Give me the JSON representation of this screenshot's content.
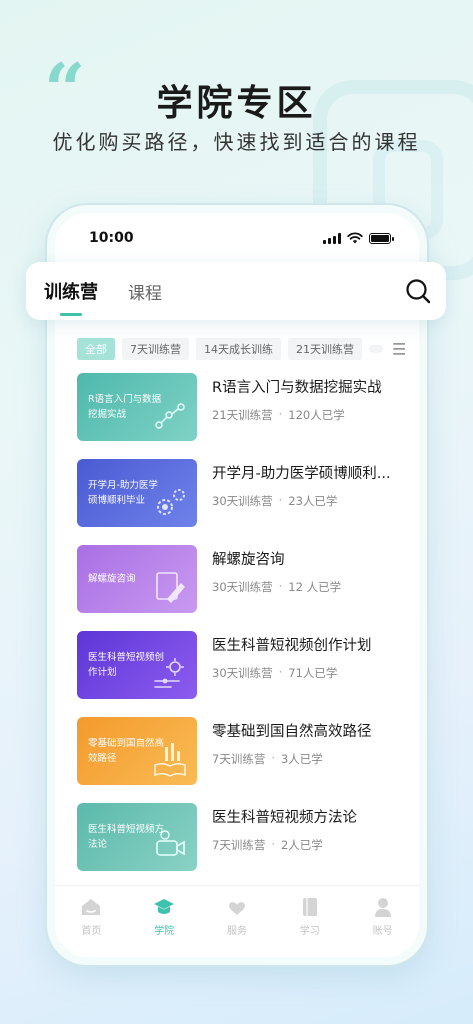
{
  "hero": {
    "quote_mark": "“",
    "title": "学院专区",
    "subtitle": "优化购买路径，快速找到适合的课程"
  },
  "status_bar": {
    "time": "10:00"
  },
  "tabs": [
    {
      "label": "训练营",
      "active": true
    },
    {
      "label": "课程",
      "active": false
    }
  ],
  "search_icon": "search-icon",
  "filters": [
    {
      "label": "全部",
      "active": true
    },
    {
      "label": "7天训练营",
      "active": false
    },
    {
      "label": "14天成长训练",
      "active": false
    },
    {
      "label": "21天训练营",
      "active": false
    }
  ],
  "courses": [
    {
      "thumb_text": "R语言入门与数据挖掘实战",
      "title": "R语言入门与数据挖掘实战",
      "camp": "21天训练营",
      "learners": "120人已学",
      "thumb_color": "#5cc1b6"
    },
    {
      "thumb_text": "开学月-助力医学硕博顺利毕业",
      "title": "开学月-助力医学硕博顺利...",
      "camp": "30天训练营",
      "learners": "23人已学",
      "thumb_color": "#5566d9"
    },
    {
      "thumb_text": "解螺旋咨询",
      "title": "解螺旋咨询",
      "camp": "30天训练营",
      "learners": "12 人已学",
      "thumb_color": "#b77ee8"
    },
    {
      "thumb_text": "医生科普短视频创作计划",
      "title": "医生科普短视频创作计划",
      "camp": "30天训练营",
      "learners": "71人已学",
      "thumb_color": "#6a3fe0"
    },
    {
      "thumb_text": "零基础到国自然高效路径",
      "title": "零基础到国自然高效路径",
      "camp": "7天训练营",
      "learners": "3人已学",
      "thumb_color": "#f6a43a"
    },
    {
      "thumb_text": "医生科普短视频方法论",
      "title": "医生科普短视频方法论",
      "camp": "7天训练营",
      "learners": "2人已学",
      "thumb_color": "#69c2b3"
    }
  ],
  "meta_separator": "·",
  "nav": [
    {
      "label": "首页",
      "icon": "home-icon",
      "active": false
    },
    {
      "label": "学院",
      "icon": "graduation-cap-icon",
      "active": true
    },
    {
      "label": "服务",
      "icon": "heart-hands-icon",
      "active": false
    },
    {
      "label": "学习",
      "icon": "book-icon",
      "active": false
    },
    {
      "label": "账号",
      "icon": "user-icon",
      "active": false
    }
  ],
  "colors": {
    "accent": "#3fc2ad",
    "filter_active": "#a5e3d9",
    "nav_inactive": "#c4c4c4"
  }
}
